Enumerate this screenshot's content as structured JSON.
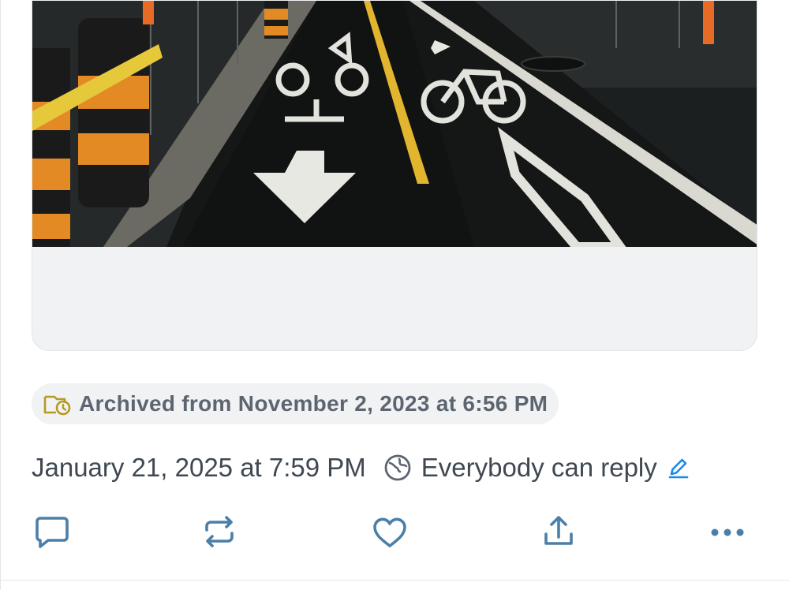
{
  "post": {
    "archived_label": "Archived from November 2, 2023 at 6:56 PM",
    "posted_at": "January 21, 2025 at 7:59 PM",
    "reply_setting": "Everybody can reply"
  },
  "media": {
    "alt": "Night photo of a bike lane with painted bicycle symbols, arrows, a yellow center line, and orange and black construction barrels wrapped in caution tape"
  },
  "actions": [
    "reply",
    "repost",
    "like",
    "share",
    "more"
  ],
  "colors": {
    "icon": "#4a7fa8",
    "text": "#3f4852",
    "muted": "#5d6670",
    "highlight": "#fff3b8",
    "edit": "#1e88e5"
  }
}
